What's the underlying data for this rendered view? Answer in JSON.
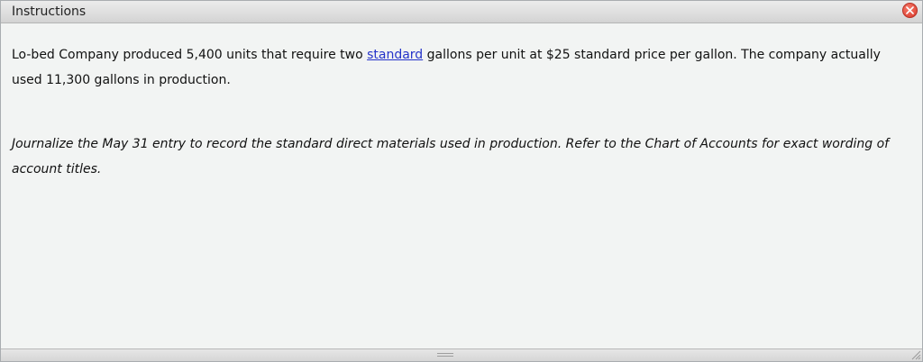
{
  "dialog": {
    "title": "Instructions",
    "close_icon": "close-icon"
  },
  "content": {
    "para1_before": "Lo-bed Company produced 5,400 units that require two ",
    "para1_link": "standard",
    "para1_after": " gallons per unit at $25 standard price per gallon. The company actually used 11,300 gallons in production.",
    "para2": "Journalize the May 31 entry to record the standard direct materials used in production. Refer to the Chart of Accounts for exact wording of account titles."
  },
  "colors": {
    "link": "#2433c9",
    "close": "#d9382a"
  }
}
